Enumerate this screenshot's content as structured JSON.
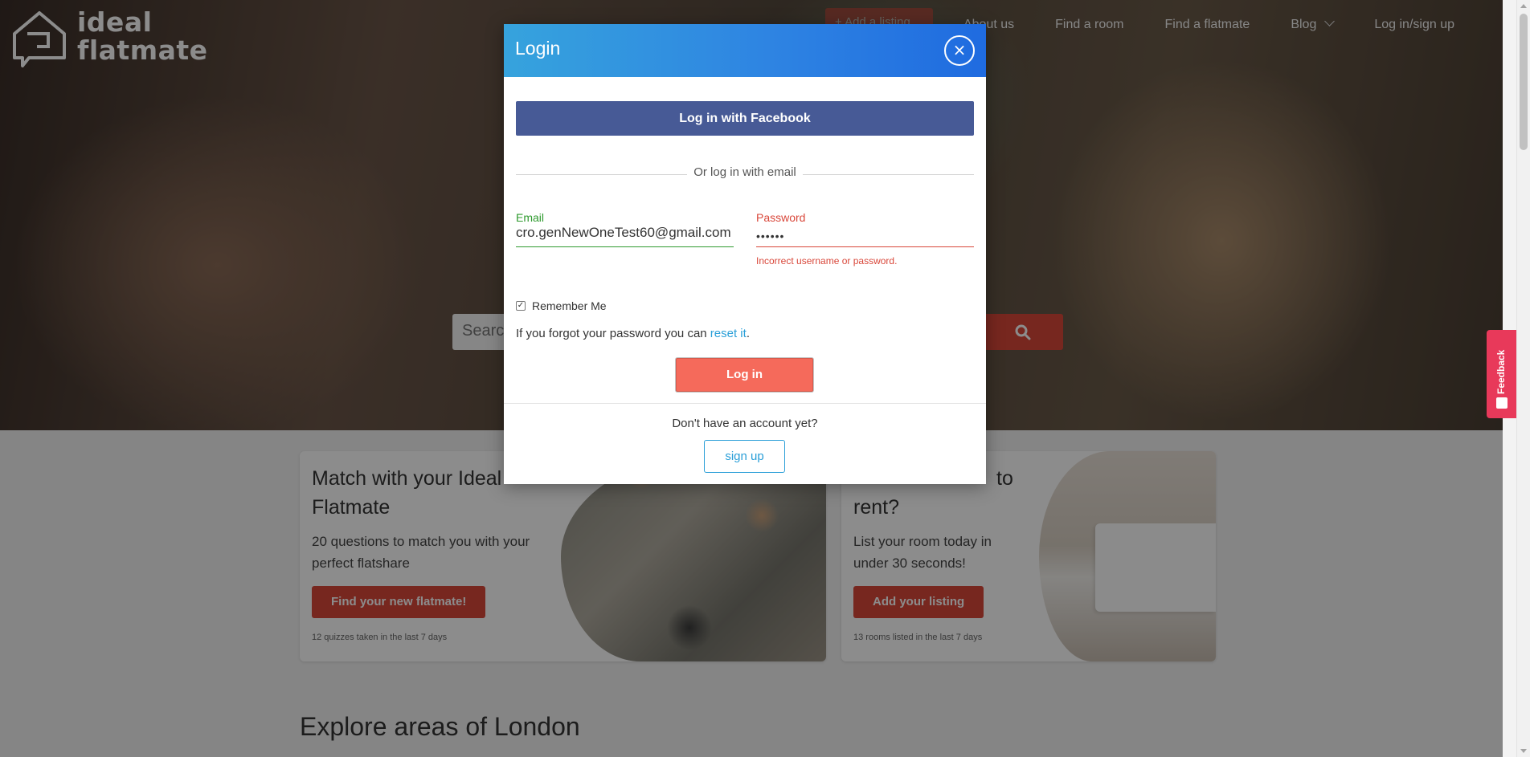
{
  "header": {
    "logo_text_line1": "ideal",
    "logo_text_line2": "flatmate",
    "add_listing_label": "+ Add a listing",
    "nav": [
      "About us",
      "Find a room",
      "Find a flatmate",
      "Blog",
      "Log in/sign up"
    ]
  },
  "search": {
    "placeholder": "Search"
  },
  "cards": [
    {
      "title": "Match with your Ideal Flatmate",
      "description": "20 questions to match you with your perfect flatshare",
      "cta": "Find your new flatmate!",
      "footnote": "12 quizzes taken in the last 7 days"
    },
    {
      "title": "rent?",
      "title_fragment": "to",
      "description": "List your room today in under 30 seconds!",
      "cta": "Add your listing",
      "footnote": "13 rooms listed in the last 7 days"
    }
  ],
  "explore": {
    "title": "Explore areas of London"
  },
  "feedback": {
    "label": "Feedback"
  },
  "modal": {
    "title": "Login",
    "close_symbol": "×",
    "facebook_label": "Log in with Facebook",
    "or_text": "Or log in with email",
    "email_label": "Email",
    "email_value": "cro.genNewOneTest60@gmail.com",
    "password_label": "Password",
    "password_value": "••••••",
    "error_text": "Incorrect username or password.",
    "remember_label": "Remember Me",
    "remember_checked": true,
    "forgot_prefix": "If you forgot your password you can ",
    "forgot_link": "reset it",
    "forgot_suffix": ".",
    "login_label": "Log in",
    "no_account_text": "Don't have an account yet?",
    "signup_label": "sign up"
  },
  "colors": {
    "brand_red": "#d9473a",
    "login_btn": "#f56a5b",
    "facebook": "#475a96",
    "header_gradient_start": "#36a3dd",
    "header_gradient_end": "#1f6be0",
    "link_blue": "#2a9fd8",
    "success_green": "#2e9a2e",
    "feedback_pink": "#e8395a"
  },
  "icons": [
    "logo-speech-house-icon",
    "search-icon",
    "chevron-down-icon",
    "close-icon",
    "checkbox-check-icon",
    "feedback-icon"
  ]
}
